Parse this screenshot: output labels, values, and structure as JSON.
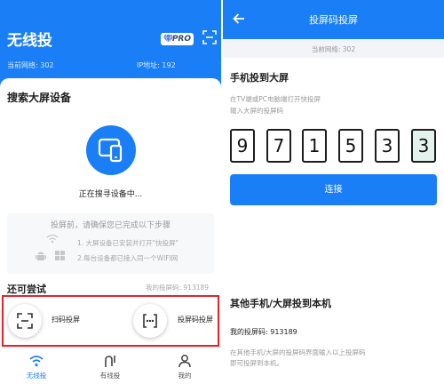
{
  "left": {
    "app_title": "无线投",
    "pro_badge": "PRO",
    "network": "当前网络: 302",
    "ip": "IP地址: 192",
    "search_title": "搜索大屏设备",
    "searching": "正在搜寻设备中...",
    "steps_title": "投屏前，请确保您已完成以下步骤",
    "steps": [
      "1. 大屏设备已安装并打开\"快投屏\"",
      "2.每台设备都已接入同一个WIFI网"
    ],
    "try_title": "还可尝试",
    "my_code": "我的投屏码: 913189",
    "options": [
      "扫码投屏",
      "投屏码投屏"
    ],
    "tabs": [
      "无线投",
      "有线投",
      "我的"
    ]
  },
  "right": {
    "title": "投屏码投屏",
    "network": "当前网络: 302",
    "section1_title": "手机投到大屏",
    "hint1": "在TV端或PC电脑端打开快投屏",
    "hint2": "输入大屏的投屏码",
    "code_digits": [
      "9",
      "7",
      "1",
      "5",
      "3",
      "3"
    ],
    "connect_label": "连接",
    "section2_title": "其他手机/大屏投到本机",
    "my_code": "我的投屏码: 913189",
    "hint3": "在其他手机/大屏的投屏码界面输入以上投屏码",
    "hint4": "即可投屏到本机。"
  },
  "colors": {
    "brand_blue": "#1a7ef6",
    "highlight_red": "#e0262b",
    "active_code_bg": "#e3f2ec"
  }
}
